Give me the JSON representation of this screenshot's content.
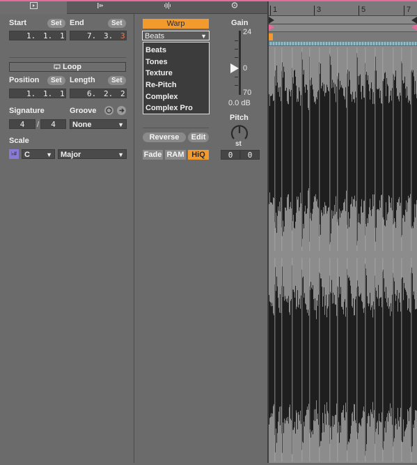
{
  "tabs": [
    {
      "icon": "clip-tab-icon"
    },
    {
      "icon": "envelope-tab-icon"
    },
    {
      "icon": "sample-tab-icon"
    },
    {
      "icon": "settings-tab-icon"
    }
  ],
  "clip": {
    "start_label": "Start",
    "end_label": "End",
    "set_label": "Set",
    "start": [
      "1.",
      "1.",
      "1"
    ],
    "end": [
      "7.",
      "3.",
      "3"
    ],
    "loop_label": "Loop",
    "position_label": "Position",
    "length_label": "Length",
    "position": [
      "1.",
      "1.",
      "1"
    ],
    "length": [
      "6.",
      "2.",
      "2"
    ],
    "signature_label": "Signature",
    "groove_label": "Groove",
    "sig_num": "4",
    "sig_sep": "/",
    "sig_den": "4",
    "groove_value": "None",
    "scale_label": "Scale",
    "scale_root": "C",
    "scale_mode": "Major",
    "scale_icon_text": "♭#"
  },
  "sample": {
    "warp_label": "Warp",
    "warp_mode": "Beats",
    "warp_modes": [
      "Beats",
      "Tones",
      "Texture",
      "Re-Pitch",
      "Complex",
      "Complex Pro"
    ],
    "reverse_label": "Reverse",
    "edit_label": "Edit",
    "fade_label": "Fade",
    "ram_label": "RAM",
    "hiq_label": "HiQ",
    "gain_label": "Gain",
    "gain_max": "24",
    "gain_mid": "0",
    "gain_min": "70",
    "gain_value": "0.0 dB",
    "pitch_label": "Pitch",
    "pitch_unit": "st",
    "pitch_semitones": "0",
    "pitch_cents": "0"
  },
  "ruler": {
    "bars": [
      "1",
      "3",
      "5",
      "7"
    ]
  },
  "colors": {
    "accent": "#f39a2e",
    "pink": "#e76b9a",
    "background": "#6b6b6b",
    "waveform": "#1e1e1e",
    "waveform_bg": "#8c8c8c"
  }
}
